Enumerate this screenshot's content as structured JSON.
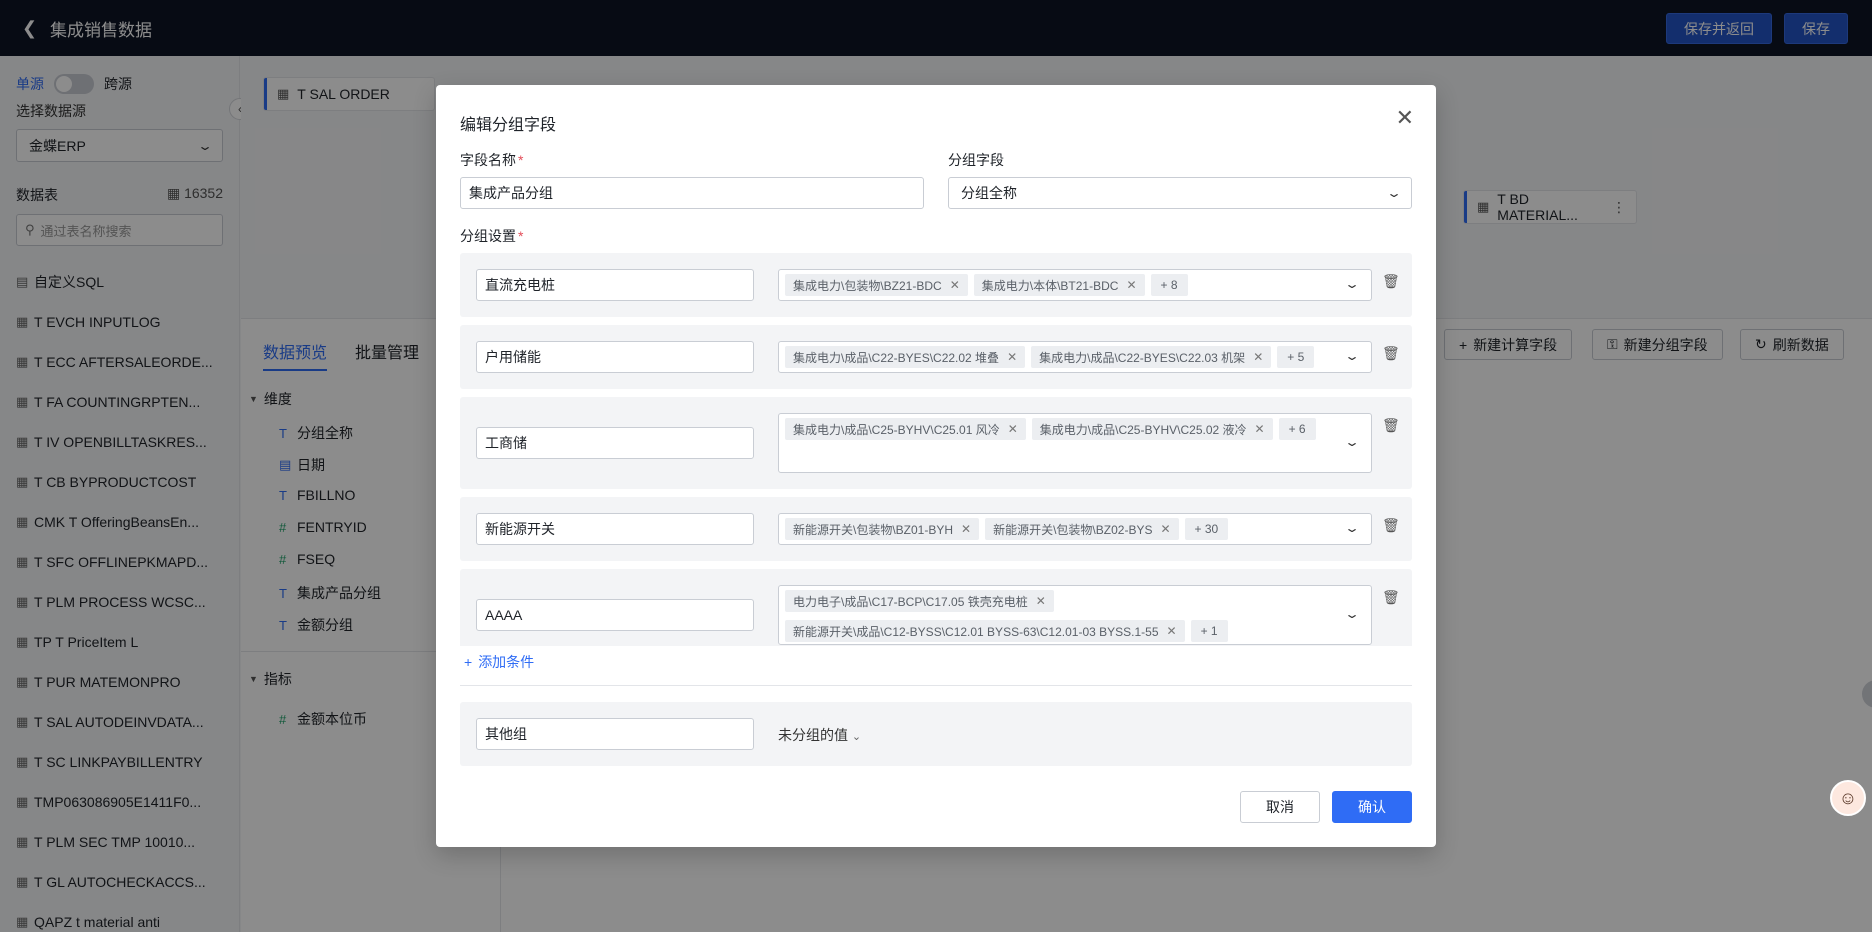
{
  "header": {
    "back_icon": "chevron-left-icon",
    "title": "集成销售数据",
    "save_return_label": "保存并返回",
    "save_label": "保存"
  },
  "sidebar": {
    "single_source": "单源",
    "cross_source": "跨源",
    "select_source_label": "选择数据源",
    "source_value": "金蝶ERP",
    "tables_label": "数据表",
    "tables_count": "16352",
    "search_placeholder": "通过表名称搜索",
    "items": [
      {
        "icon": "sql-icon",
        "label": "自定义SQL"
      },
      {
        "icon": "table-icon",
        "label": "T EVCH INPUTLOG"
      },
      {
        "icon": "table-icon",
        "label": "T ECC AFTERSALEORDE..."
      },
      {
        "icon": "table-icon",
        "label": "T FA COUNTINGRPTEN..."
      },
      {
        "icon": "table-icon",
        "label": "T IV OPENBILLTASKRES..."
      },
      {
        "icon": "table-icon",
        "label": "T CB BYPRODUCTCOST"
      },
      {
        "icon": "table-icon",
        "label": "CMK T OfferingBeansEn..."
      },
      {
        "icon": "table-icon",
        "label": "T SFC OFFLINEPKMAPD..."
      },
      {
        "icon": "table-icon",
        "label": "T PLM PROCESS WCSC..."
      },
      {
        "icon": "table-icon",
        "label": "TP T PriceItem L"
      },
      {
        "icon": "table-icon",
        "label": "T PUR MATEMONPRO"
      },
      {
        "icon": "table-icon",
        "label": "T SAL AUTODEINVDATA..."
      },
      {
        "icon": "table-icon",
        "label": "T SC LINKPAYBILLENTRY"
      },
      {
        "icon": "table-icon",
        "label": "TMP063086905E1411F0..."
      },
      {
        "icon": "table-icon",
        "label": "T PLM SEC TMP 10010..."
      },
      {
        "icon": "table-icon",
        "label": "T GL AUTOCHECKACCS..."
      },
      {
        "icon": "table-icon",
        "label": "QAPZ t material anti"
      }
    ]
  },
  "canvas": {
    "node_main": "T SAL ORDER",
    "node_material": "T BD MATERIAL..."
  },
  "lower": {
    "tab_preview": "数据预览",
    "tab_batch": "批量管理",
    "dimension_label": "维度",
    "dimensions": [
      {
        "type": "T",
        "name": "分组全称"
      },
      {
        "type": "date",
        "name": "日期"
      },
      {
        "type": "T",
        "name": "FBILLNO"
      },
      {
        "type": "#",
        "name": "FENTRYID"
      },
      {
        "type": "#",
        "name": "FSEQ"
      },
      {
        "type": "T",
        "name": "集成产品分组"
      },
      {
        "type": "T",
        "name": "金额分组"
      }
    ],
    "metric_label": "指标",
    "metrics": [
      {
        "type": "#",
        "name": "金额本位币"
      }
    ],
    "btn_new_calc": "新建计算字段",
    "btn_new_group": "新建分组字段",
    "btn_refresh": "刷新数据"
  },
  "modal": {
    "title": "编辑分组字段",
    "field_name_label": "字段名称",
    "field_name_value": "集成产品分组",
    "group_field_label": "分组字段",
    "group_field_value": "分组全称",
    "group_settings_label": "分组设置",
    "groups": [
      {
        "name": "直流充电桩",
        "chips": [
          "集成电力\\包装物\\BZ21-BDC",
          "集成电力\\本体\\BT21-BDC"
        ],
        "more": "+ 8"
      },
      {
        "name": "户用储能",
        "chips": [
          "集成电力\\成品\\C22-BYES\\C22.02 堆叠",
          "集成电力\\成品\\C22-BYES\\C22.03 机架"
        ],
        "more": "+ 5"
      },
      {
        "name": "工商储",
        "chips": [
          "集成电力\\成品\\C25-BYHV\\C25.01 风冷",
          "集成电力\\成品\\C25-BYHV\\C25.02 液冷"
        ],
        "more": "+ 6"
      },
      {
        "name": "新能源开关",
        "chips": [
          "新能源开关\\包装物\\BZ01-BYH",
          "新能源开关\\包装物\\BZ02-BYS"
        ],
        "more": "+ 30"
      },
      {
        "name": "AAAA",
        "chips": [
          "电力电子\\成品\\C17-BCP\\C17.05 铁壳充电桩",
          "新能源开关\\成品\\C12-BYSS\\C12.01 BYSS-63\\C12.01-03 BYSS.1-55"
        ],
        "more": "+ 1"
      }
    ],
    "add_condition": "添加条件",
    "other_group_name": "其他组",
    "other_group_label": "未分组的值",
    "cancel_label": "取消",
    "confirm_label": "确认"
  },
  "colors": {
    "accent": "#2f6cf5",
    "topbar": "#0e1526",
    "required": "#e34d59"
  }
}
